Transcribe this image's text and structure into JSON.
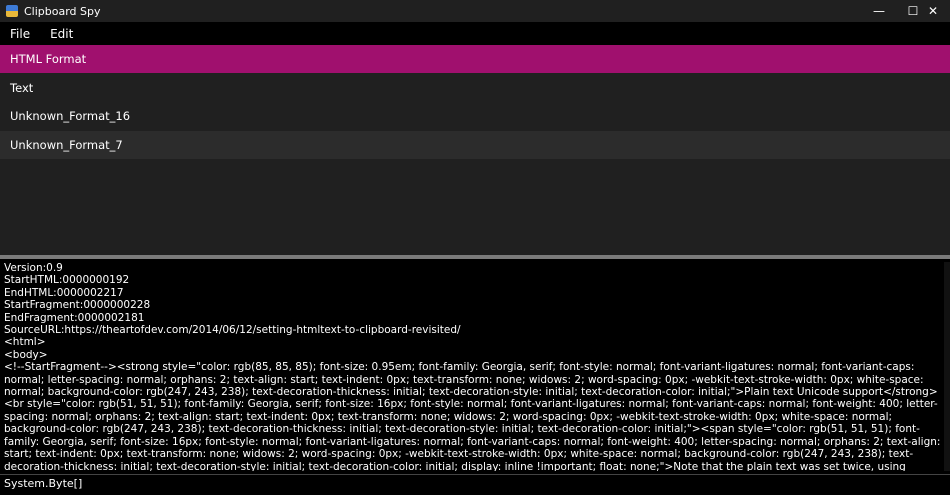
{
  "window": {
    "title": "Clipboard Spy",
    "minimize_glyph": "—",
    "maximize_glyph": "☐",
    "close_glyph": "✕"
  },
  "menu": {
    "file": "File",
    "edit": "Edit"
  },
  "formats": [
    {
      "label": "HTML Format",
      "selected": true
    },
    {
      "label": "Text",
      "selected": false
    },
    {
      "label": "Unknown_Format_16",
      "selected": false
    },
    {
      "label": "Unknown_Format_7",
      "selected": false
    }
  ],
  "content": {
    "text": "Version:0.9\nStartHTML:0000000192\nEndHTML:0000002217\nStartFragment:0000000228\nEndFragment:0000002181\nSourceURL:https://theartofdev.com/2014/06/12/setting-htmltext-to-clipboard-revisited/\n<html>\n<body>\n<!--StartFragment--><strong style=\"color: rgb(85, 85, 85); font-size: 0.95em; font-family: Georgia, serif; font-style: normal; font-variant-ligatures: normal; font-variant-caps: normal; letter-spacing: normal; orphans: 2; text-align: start; text-indent: 0px; text-transform: none; widows: 2; word-spacing: 0px; -webkit-text-stroke-width: 0px; white-space: normal; background-color: rgb(247, 243, 238); text-decoration-thickness: initial; text-decoration-style: initial; text-decoration-color: initial;\">Plain text Unicode support</strong><br style=\"color: rgb(51, 51, 51); font-family: Georgia, serif; font-size: 16px; font-style: normal; font-variant-ligatures: normal; font-variant-caps: normal; font-weight: 400; letter-spacing: normal; orphans: 2; text-align: start; text-indent: 0px; text-transform: none; widows: 2; word-spacing: 0px; -webkit-text-stroke-width: 0px; white-space: normal; background-color: rgb(247, 243, 238); text-decoration-thickness: initial; text-decoration-style: initial; text-decoration-color: initial;\"><span style=\"color: rgb(51, 51, 51); font-family: Georgia, serif; font-size: 16px; font-style: normal; font-variant-ligatures: normal; font-variant-caps: normal; font-weight: 400; letter-spacing: normal; orphans: 2; text-align: start; text-indent: 0px; text-transform: none; widows: 2; word-spacing: 0px; -webkit-text-stroke-width: 0px; white-space: normal; background-color: rgb(247, 243, 238); text-decoration-thickness: initial; text-decoration-style: initial; text-decoration-color: initial; display: inline !important; float: none;\">Note that the plain text was set twice, using regular and Unicode format. It is important to set both as without the regular"
  },
  "status": {
    "text": "System.Byte[]"
  },
  "colors": {
    "selection": "#a0106e",
    "titlebar": "#202020",
    "list_bg": "#202020",
    "list_alt": "#2c2c2c",
    "splitter": "#7a7a7a"
  },
  "icons": {
    "app": "clipboard-spy-app-icon",
    "minimize": "minimize-icon",
    "maximize": "maximize-icon",
    "close": "close-icon"
  }
}
